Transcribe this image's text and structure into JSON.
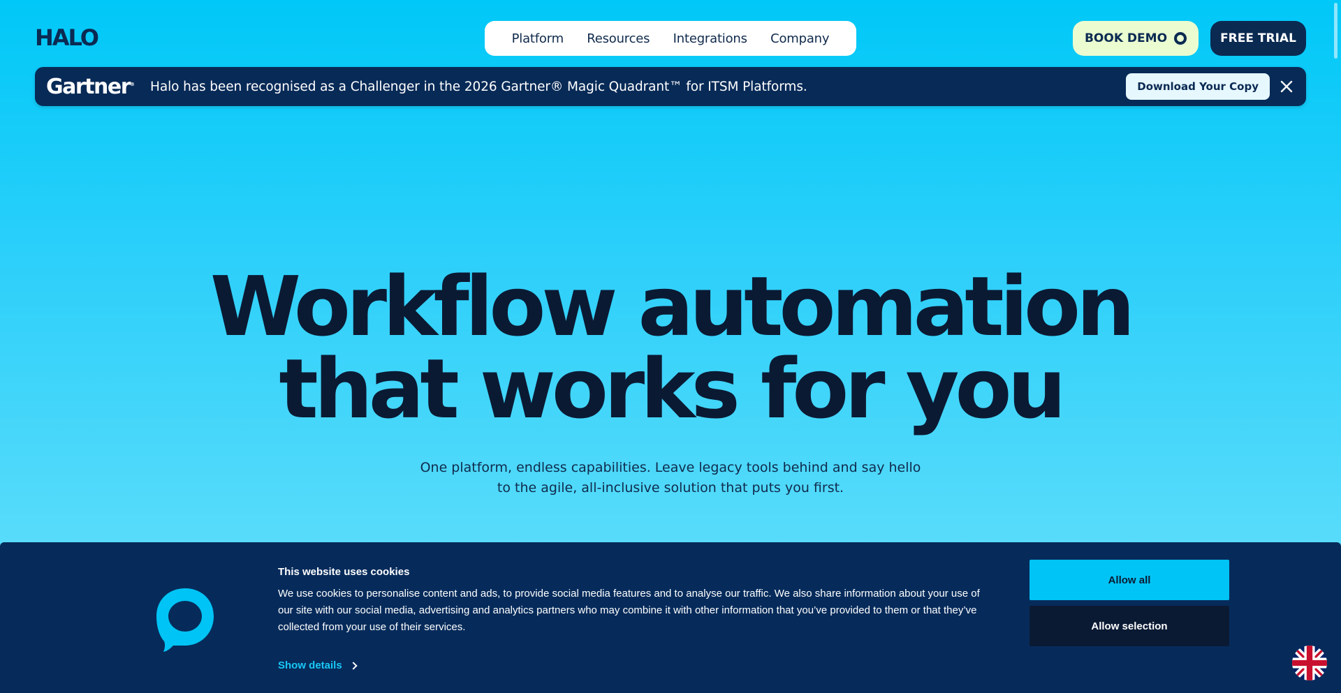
{
  "header": {
    "logo_text": "HALO",
    "nav": [
      "Platform",
      "Resources",
      "Integrations",
      "Company"
    ],
    "book_demo_label": "BOOK DEMO",
    "free_trial_label": "FREE TRIAL"
  },
  "banner": {
    "brand": "Gartner",
    "text": "Halo has been recognised as a Challenger in the 2026 Gartner® Magic Quadrant™ for ITSM Platforms.",
    "cta_label": "Download Your Copy",
    "close_icon": "close-icon"
  },
  "hero": {
    "title_line1": "Workflow automation",
    "title_line2": "that works for you",
    "subtitle": "One platform, endless capabilities. Leave legacy tools behind and say hello to the agile, all-inclusive solution that puts you first."
  },
  "cookie": {
    "title": "This website uses cookies",
    "text": "We use cookies to personalise content and ads, to provide social media features and to analyse our traffic. We also share information about your use of our site with our social media, advertising and analytics partners who may combine it with other information that you’ve provided to them or that they’ve collected from your use of their services.",
    "details_label": "Show details",
    "allow_all_label": "Allow all",
    "allow_selection_label": "Allow selection"
  },
  "colors": {
    "brand_navy": "#0b2a52",
    "accent_cyan": "#00c4f5",
    "demo_bg": "#eafcd0"
  },
  "icons": {
    "language": "uk-flag-icon",
    "chat": "chat-bubble-icon"
  }
}
